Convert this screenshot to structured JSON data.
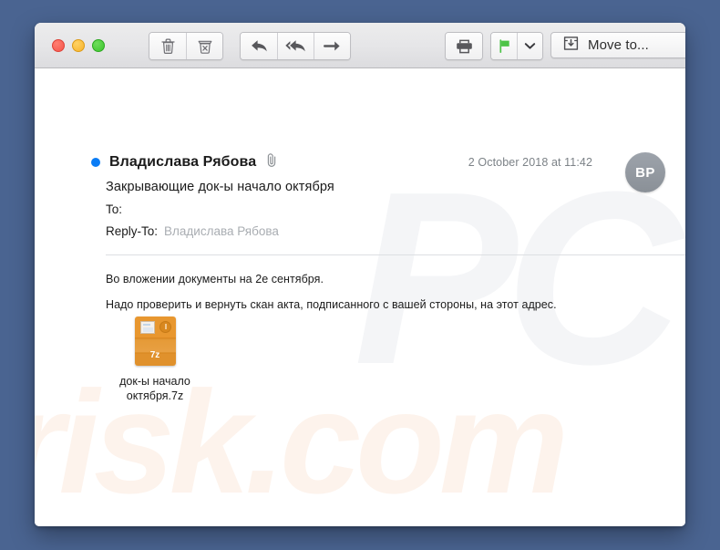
{
  "desktop": {
    "background_color": "#4a6491"
  },
  "window": {
    "toolbar": {
      "traffic_lights": [
        {
          "name": "close",
          "color": "#f5544a"
        },
        {
          "name": "minimize",
          "color": "#f7b32b"
        },
        {
          "name": "zoom",
          "color": "#3bc52c"
        }
      ],
      "buttons": [
        {
          "name": "delete",
          "icon": "trash-icon",
          "label": ""
        },
        {
          "name": "junk",
          "icon": "junk-icon",
          "label": ""
        },
        {
          "name": "reply",
          "icon": "reply-arrow-icon",
          "label": ""
        },
        {
          "name": "reply-all",
          "icon": "reply-all-arrow-icon",
          "label": ""
        },
        {
          "name": "forward",
          "icon": "forward-arrow-icon",
          "label": ""
        },
        {
          "name": "print",
          "icon": "printer-icon",
          "label": ""
        },
        {
          "name": "flag",
          "icon": "flag-icon",
          "label": ""
        },
        {
          "name": "flag-menu",
          "icon": "chevron-down-icon",
          "label": ""
        }
      ],
      "flag_color": "#4cc346",
      "move_to": {
        "label": "Move to...",
        "icon": "move-to-tray-icon"
      }
    },
    "message": {
      "unread_dot_color": "#0a7cf5",
      "sender": "Владислава Рябова",
      "attachment_indicator_icon": "paperclip-icon",
      "date": "2 October 2018 at 11:42",
      "avatar_initials": "BP",
      "subject": "Закрывающие док-ы начало октября",
      "to_label": "To:",
      "to_value": "",
      "reply_to_label": "Reply-To:",
      "reply_to_value": "Владислава Рябова",
      "body_paragraphs": [
        "Во вложении документы на 2е сентября.",
        "Надо проверить и вернуть скан акта, подписанного с вашей стороны, на этот адрес."
      ],
      "attachment": {
        "file_name_line_1": "док-ы начало",
        "file_name_line_2": "октября.7z",
        "format_label": "7z",
        "icon_color": "#e8972f"
      }
    },
    "watermarks": {
      "top": "PC",
      "bottom": "risk.com"
    }
  }
}
